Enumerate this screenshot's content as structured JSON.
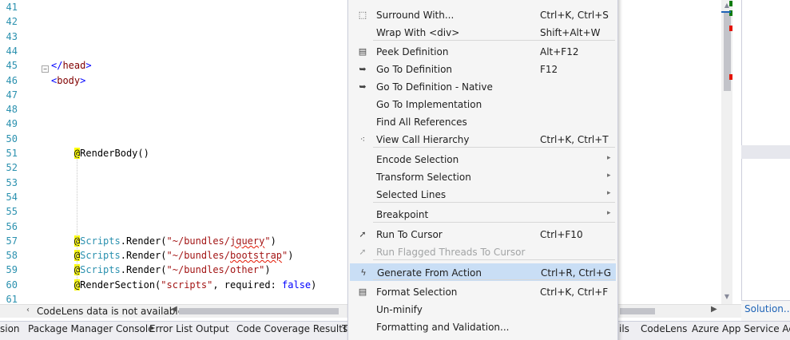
{
  "editor": {
    "lines": [
      {
        "num": "41",
        "tokens": []
      },
      {
        "num": "42",
        "tokens": []
      },
      {
        "num": "43",
        "tokens": []
      },
      {
        "num": "44",
        "tokens": []
      },
      {
        "num": "45",
        "tokens": [
          {
            "t": "</",
            "c": "punct"
          },
          {
            "t": "head",
            "c": "tag"
          },
          {
            "t": ">",
            "c": "punct"
          }
        ]
      },
      {
        "num": "46",
        "tokens": [
          {
            "t": "<",
            "c": "punct"
          },
          {
            "t": "body",
            "c": "tag"
          },
          {
            "t": ">",
            "c": "punct"
          }
        ]
      },
      {
        "num": "47",
        "tokens": []
      },
      {
        "num": "48",
        "tokens": []
      },
      {
        "num": "49",
        "tokens": []
      },
      {
        "num": "50",
        "tokens": []
      },
      {
        "num": "51",
        "tokens": [
          {
            "t": "    ",
            "c": "plain"
          },
          {
            "t": "@",
            "c": "razor"
          },
          {
            "t": "RenderBody()",
            "c": "plain"
          }
        ]
      },
      {
        "num": "52",
        "tokens": []
      },
      {
        "num": "53",
        "tokens": []
      },
      {
        "num": "54",
        "tokens": []
      },
      {
        "num": "55",
        "tokens": []
      },
      {
        "num": "56",
        "tokens": []
      },
      {
        "num": "57",
        "tokens": [
          {
            "t": "    ",
            "c": "plain"
          },
          {
            "t": "@",
            "c": "razor"
          },
          {
            "t": "Scripts",
            "c": "type"
          },
          {
            "t": ".Render(",
            "c": "plain"
          },
          {
            "t": "\"~/bundles/",
            "c": "string"
          },
          {
            "t": "jquery",
            "c": "string squiggle"
          },
          {
            "t": "\"",
            "c": "string"
          },
          {
            "t": ")",
            "c": "plain"
          }
        ]
      },
      {
        "num": "58",
        "tokens": [
          {
            "t": "    ",
            "c": "plain"
          },
          {
            "t": "@",
            "c": "razor"
          },
          {
            "t": "Scripts",
            "c": "type"
          },
          {
            "t": ".Render(",
            "c": "plain"
          },
          {
            "t": "\"~/bundles/",
            "c": "string"
          },
          {
            "t": "bootstrap",
            "c": "string squiggle"
          },
          {
            "t": "\"",
            "c": "string"
          },
          {
            "t": ")",
            "c": "plain"
          }
        ]
      },
      {
        "num": "59",
        "tokens": [
          {
            "t": "    ",
            "c": "plain"
          },
          {
            "t": "@",
            "c": "razor"
          },
          {
            "t": "Scripts",
            "c": "type"
          },
          {
            "t": ".Render(",
            "c": "plain"
          },
          {
            "t": "\"~/bundles/other\"",
            "c": "string"
          },
          {
            "t": ")",
            "c": "plain"
          }
        ]
      },
      {
        "num": "60",
        "tokens": [
          {
            "t": "    ",
            "c": "plain"
          },
          {
            "t": "@",
            "c": "razor"
          },
          {
            "t": "RenderSection(",
            "c": "plain"
          },
          {
            "t": "\"scripts\"",
            "c": "string"
          },
          {
            "t": ", required: ",
            "c": "plain"
          },
          {
            "t": "false",
            "c": "keyword"
          },
          {
            "t": ")",
            "c": "plain"
          }
        ]
      },
      {
        "num": "61",
        "tokens": []
      }
    ],
    "collapse_glyph": "−",
    "vscroll_up": "▲",
    "vscroll_down": "▼",
    "marker_colors": {
      "change": "#107c10",
      "error": "#e51400",
      "caret": "#1e63b6"
    }
  },
  "statusbar": {
    "codelens_text": "CodeLens data is not available",
    "left_arrow": "‹",
    "hscroll_left": "◀",
    "hscroll_right": "▶"
  },
  "right_panel": {
    "solution_link": "Solution..."
  },
  "context_menu": {
    "items": [
      {
        "label": "Surround With...",
        "shortcut": "Ctrl+K, Ctrl+S",
        "icon": "surround-icon",
        "glyph": "⬚"
      },
      {
        "label": "Wrap With <div>",
        "shortcut": "Shift+Alt+W",
        "icon": "",
        "glyph": ""
      },
      {
        "label": "Peek Definition",
        "shortcut": "Alt+F12",
        "icon": "peek-definition-icon",
        "glyph": "▤"
      },
      {
        "label": "Go To Definition",
        "shortcut": "F12",
        "icon": "go-to-definition-icon",
        "glyph": "➥"
      },
      {
        "label": "Go To Definition - Native",
        "shortcut": "",
        "icon": "go-to-definition-native-icon",
        "glyph": "➥"
      },
      {
        "label": "Go To Implementation",
        "shortcut": "",
        "icon": "",
        "glyph": ""
      },
      {
        "label": "Find All References",
        "shortcut": "",
        "icon": "",
        "glyph": ""
      },
      {
        "label": "View Call Hierarchy",
        "shortcut": "Ctrl+K, Ctrl+T",
        "icon": "call-hierarchy-icon",
        "glyph": "⁖"
      },
      {
        "label": "Encode Selection",
        "shortcut": "",
        "submenu": "▸"
      },
      {
        "label": "Transform Selection",
        "shortcut": "",
        "submenu": "▸"
      },
      {
        "label": "Selected Lines",
        "shortcut": "",
        "submenu": "▸"
      },
      {
        "label": "Breakpoint",
        "shortcut": "",
        "submenu": "▸"
      },
      {
        "label": "Run To Cursor",
        "shortcut": "Ctrl+F10",
        "icon": "cursor-arrow-icon",
        "glyph": "➚"
      },
      {
        "label": "Run Flagged Threads To Cursor",
        "shortcut": "",
        "icon": "cursor-arrow-disabled-icon",
        "glyph": "➚",
        "disabled": true
      },
      {
        "label": "Generate From Action",
        "shortcut": "Ctrl+R, Ctrl+G",
        "icon": "lightning-icon",
        "glyph": "ϟ",
        "selected": true
      },
      {
        "label": "Format Selection",
        "shortcut": "Ctrl+K, Ctrl+F",
        "icon": "format-selection-icon",
        "glyph": "▤"
      },
      {
        "label": "Un-minify",
        "shortcut": ""
      },
      {
        "label": "Formatting and Validation...",
        "shortcut": ""
      }
    ]
  },
  "tabs": [
    "sion",
    "Package Manager Console",
    "Error List",
    "Output",
    "Code Coverage Results",
    "T",
    "ils",
    "CodeLens",
    "Azure App Service Activ"
  ]
}
